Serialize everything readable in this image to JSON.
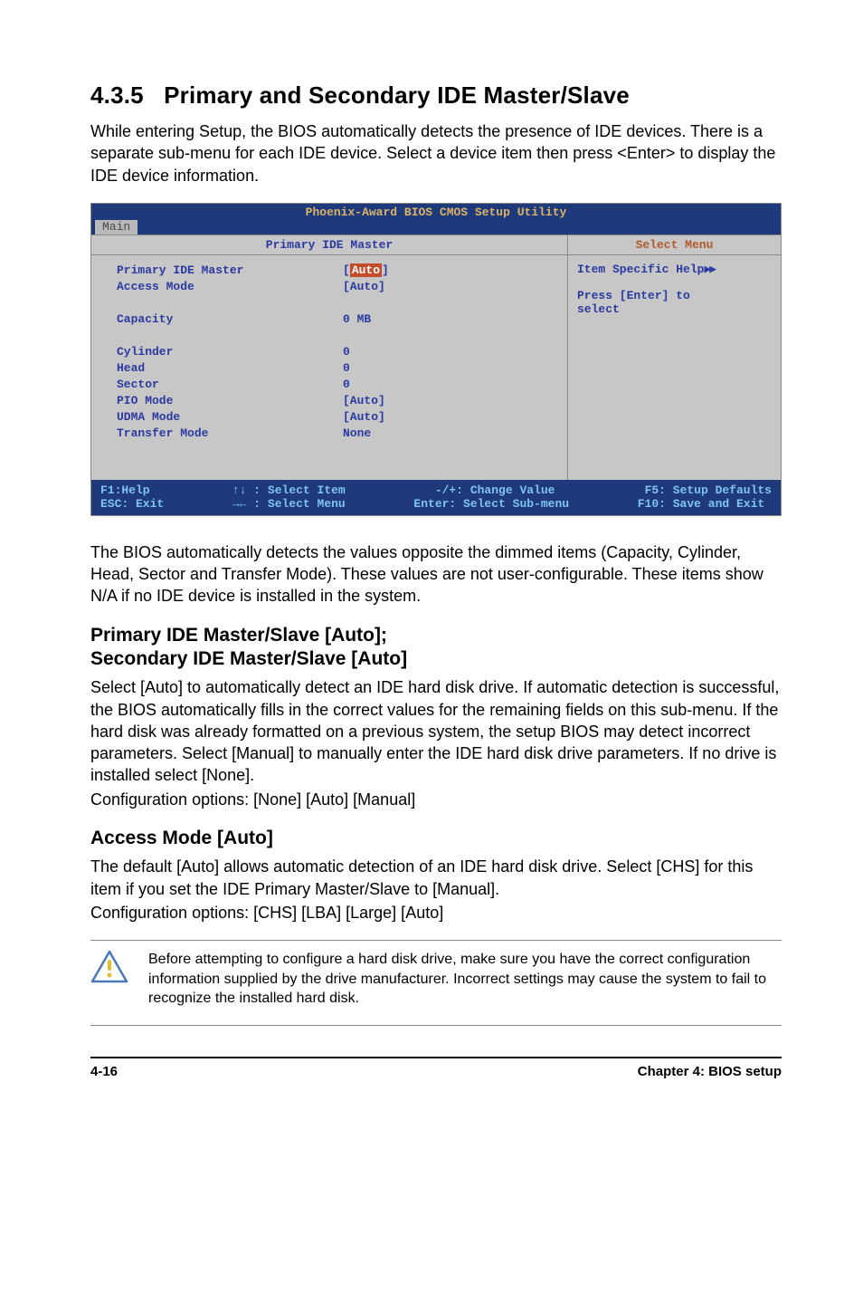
{
  "section": {
    "number": "4.3.5",
    "title": "Primary and Secondary IDE Master/Slave",
    "intro": "While entering Setup, the BIOS automatically detects the presence of IDE devices. There is a separate sub-menu for each IDE device. Select a device item then press <Enter> to display the IDE device information."
  },
  "bios": {
    "title": "Phoenix-Award BIOS CMOS Setup Utility",
    "tab": "Main",
    "panel_title_left": "Primary IDE Master",
    "panel_title_right": "Select Menu",
    "items": [
      {
        "label": "Primary IDE Master",
        "value": "Auto",
        "selected": true,
        "bracketed": true
      },
      {
        "label": "Access Mode",
        "value": "[Auto]"
      },
      {
        "label": "",
        "value": ""
      },
      {
        "label": "Capacity",
        "value": "0 MB"
      },
      {
        "label": "",
        "value": ""
      },
      {
        "label": "Cylinder",
        "value": "0"
      },
      {
        "label": "Head",
        "value": "0"
      },
      {
        "label": "Sector",
        "value": "0"
      },
      {
        "label": "PIO Mode",
        "value": "[Auto]"
      },
      {
        "label": "UDMA Mode",
        "value": "[Auto]"
      },
      {
        "label": "Transfer Mode",
        "value": "None"
      }
    ],
    "help": {
      "line1": "Item Specific Help",
      "line2": "Press [Enter] to",
      "line3": "select"
    },
    "footer": {
      "col1a": "F1:Help",
      "col1b": "ESC: Exit",
      "col2a": "↑↓ : Select Item",
      "col2b": "→← : Select Menu",
      "col3a": "-/+: Change Value",
      "col3b": "Enter: Select Sub-menu",
      "col4a": "F5: Setup Defaults",
      "col4b": "F10: Save and Exit"
    }
  },
  "after_bios": "The BIOS automatically detects the values opposite the dimmed items (Capacity, Cylinder,  Head, Sector and Transfer Mode). These values are not user-configurable. These items show N/A if no IDE device is installed in the system.",
  "sub1": {
    "heading_a": "Primary IDE Master/Slave [Auto];",
    "heading_b": "Secondary IDE Master/Slave [Auto]",
    "body": "Select [Auto] to automatically detect an IDE hard disk drive. If automatic detection is successful, the BIOS automatically fills in the correct values for the remaining fields on this sub-menu. If the hard disk was already formatted on a previous system, the setup BIOS may detect incorrect parameters. Select [Manual] to manually enter the IDE hard disk drive parameters. If no drive is installed select [None].",
    "config": "Configuration options: [None] [Auto] [Manual]"
  },
  "sub2": {
    "heading": "Access Mode [Auto]",
    "body": "The default [Auto] allows automatic detection of an IDE hard disk drive. Select [CHS] for this item if you set the IDE Primary Master/Slave to [Manual].",
    "config": "Configuration options: [CHS] [LBA] [Large] [Auto]"
  },
  "note": "Before attempting to configure a hard disk drive, make sure you have the correct configuration information supplied by the drive manufacturer. Incorrect settings may cause the system to fail to recognize the installed hard disk.",
  "footer": {
    "left": "4-16",
    "right": "Chapter 4: BIOS setup"
  }
}
